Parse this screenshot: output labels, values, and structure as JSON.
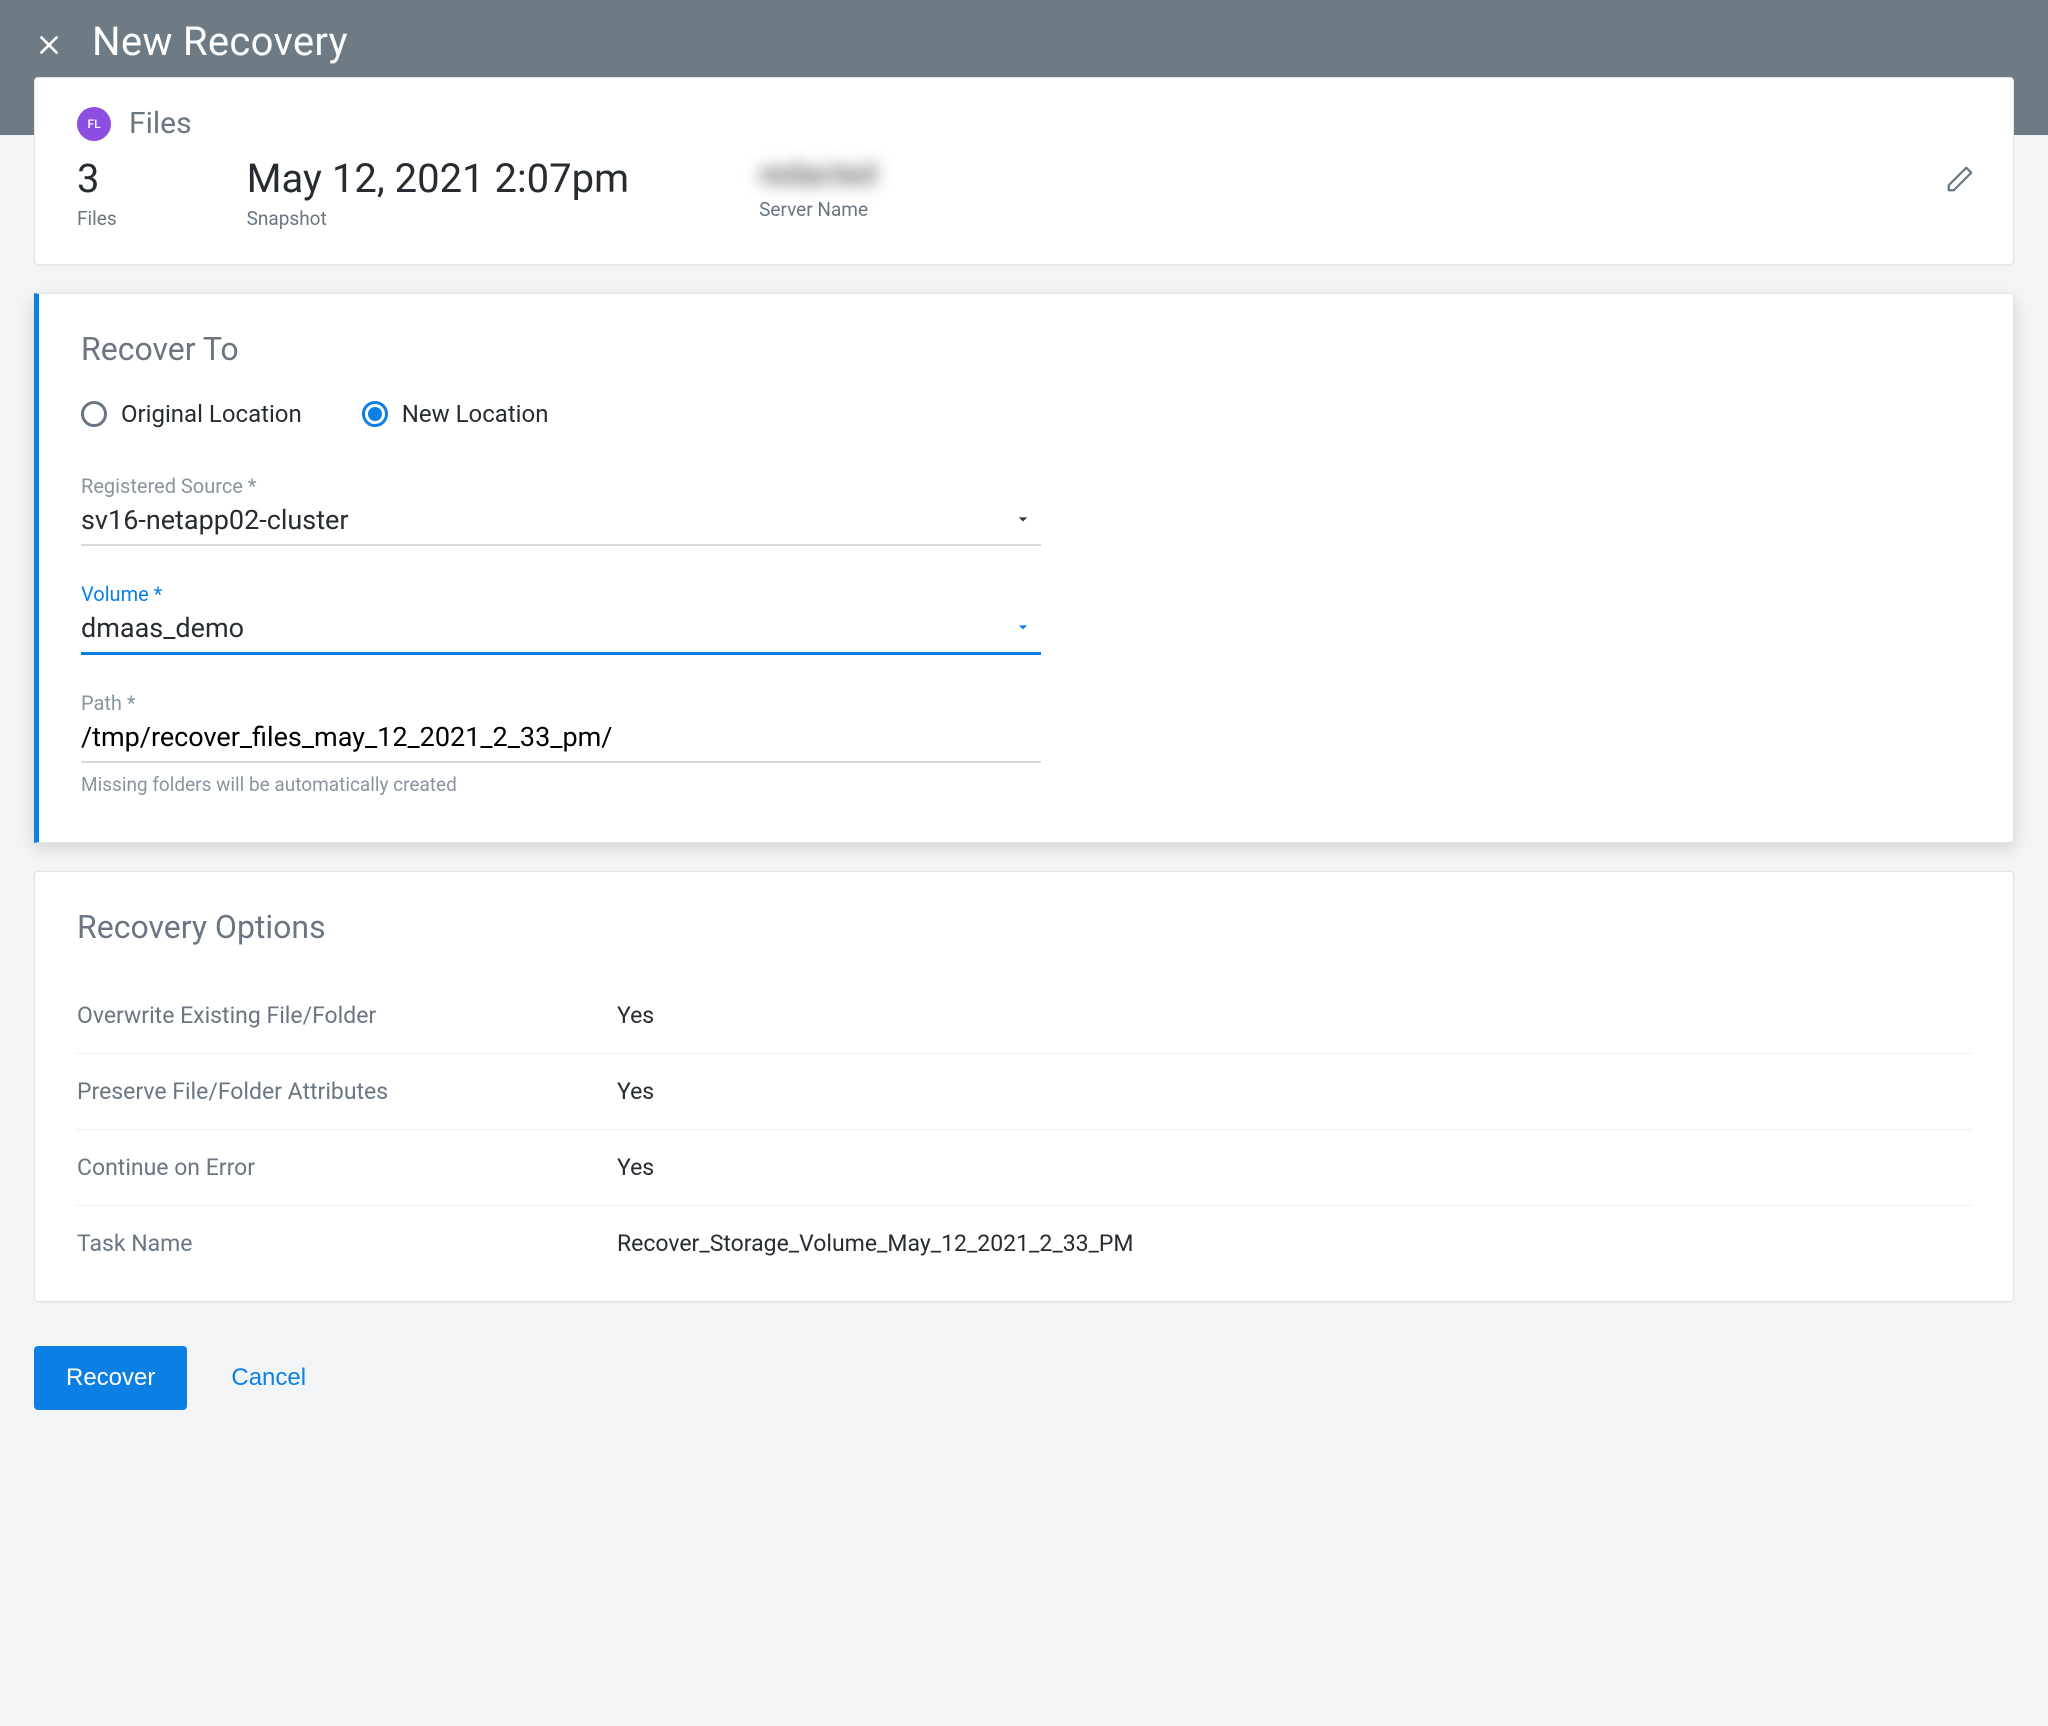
{
  "header": {
    "title": "New Recovery"
  },
  "summary": {
    "badge_text": "FL",
    "title": "Files",
    "files_count": "3",
    "files_label": "Files",
    "snapshot_time": "May 12, 2021 2:07pm",
    "snapshot_label": "Snapshot",
    "server_name_value": "redacted",
    "server_name_label": "Server Name"
  },
  "recover_to": {
    "heading": "Recover To",
    "radio_original": "Original Location",
    "radio_new": "New Location",
    "selected": "new",
    "registered_source": {
      "label": "Registered Source *",
      "value": "sv16-netapp02-cluster"
    },
    "volume": {
      "label": "Volume *",
      "value": "dmaas_demo"
    },
    "path": {
      "label": "Path *",
      "value": "/tmp/recover_files_may_12_2021_2_33_pm/",
      "helper": "Missing folders will be automatically created"
    }
  },
  "recovery_options": {
    "heading": "Recovery Options",
    "rows": [
      {
        "label": "Overwrite Existing File/Folder",
        "value": "Yes"
      },
      {
        "label": "Preserve File/Folder Attributes",
        "value": "Yes"
      },
      {
        "label": "Continue on Error",
        "value": "Yes"
      },
      {
        "label": "Task Name",
        "value": "Recover_Storage_Volume_May_12_2021_2_33_PM"
      }
    ]
  },
  "footer": {
    "recover": "Recover",
    "cancel": "Cancel"
  }
}
